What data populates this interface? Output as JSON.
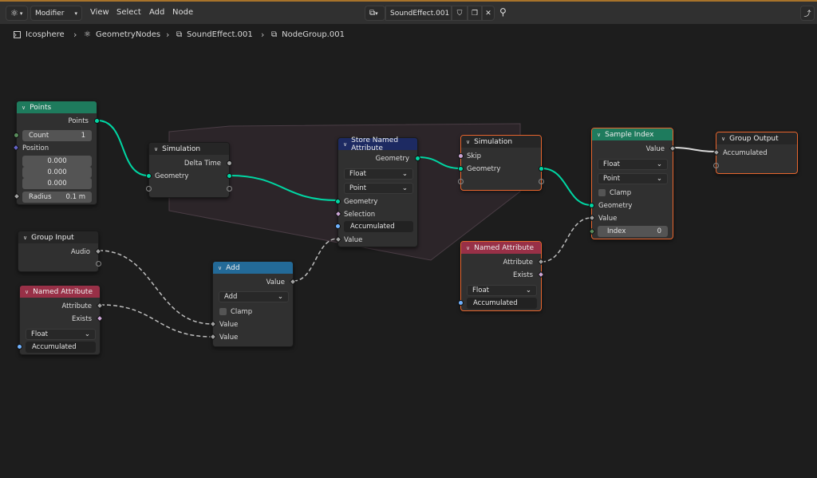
{
  "header": {
    "editor_type_icon": "node-editor-icon",
    "mode_label": "Modifier",
    "menus": [
      "View",
      "Select",
      "Add",
      "Node"
    ],
    "tree_name": "SoundEffect.001",
    "pin_icon": "pin-icon"
  },
  "breadcrumb": [
    "Icosphere",
    "GeometryNodes",
    "SoundEffect.001",
    "NodeGroup.001"
  ],
  "nodes": {
    "points": {
      "title": "Points",
      "out_points": "Points",
      "count_label": "Count",
      "count_value": "1",
      "position_label": "Position",
      "pos": [
        "0.000",
        "0.000",
        "0.000"
      ],
      "radius_label": "Radius",
      "radius_value": "0.1 m"
    },
    "sim_in": {
      "title": "Simulation",
      "delta_time": "Delta Time",
      "geometry": "Geometry"
    },
    "store": {
      "title": "Store Named Attribute",
      "out_geometry": "Geometry",
      "type": "Float",
      "domain": "Point",
      "geometry": "Geometry",
      "selection": "Selection",
      "name": "Accumulated",
      "value": "Value"
    },
    "sim_out": {
      "title": "Simulation",
      "skip": "Skip",
      "geometry": "Geometry"
    },
    "sample": {
      "title": "Sample Index",
      "out_value": "Value",
      "type": "Float",
      "domain": "Point",
      "clamp": "Clamp",
      "geometry": "Geometry",
      "value": "Value",
      "index_label": "Index",
      "index_value": "0"
    },
    "group_output": {
      "title": "Group Output",
      "accumulated": "Accumulated"
    },
    "group_input": {
      "title": "Group Input",
      "audio": "Audio"
    },
    "named_attr_1": {
      "title": "Named Attribute",
      "attribute": "Attribute",
      "exists": "Exists",
      "type": "Float",
      "name": "Accumulated"
    },
    "add": {
      "title": "Add",
      "out_value": "Value",
      "operation": "Add",
      "clamp": "Clamp",
      "value_a": "Value",
      "value_b": "Value"
    },
    "named_attr_2": {
      "title": "Named Attribute",
      "attribute": "Attribute",
      "exists": "Exists",
      "type": "Float",
      "name": "Accumulated"
    }
  },
  "colors": {
    "geometry_header": "#1e7b5d",
    "input_header": "#1e7b5d",
    "converter_header": "#236a98",
    "attribute_header": "#983047",
    "store_header": "#1d2a62",
    "group_header": "#1d1d1d",
    "active_border": "#e8662e",
    "geometry_link": "#00d6a3"
  }
}
